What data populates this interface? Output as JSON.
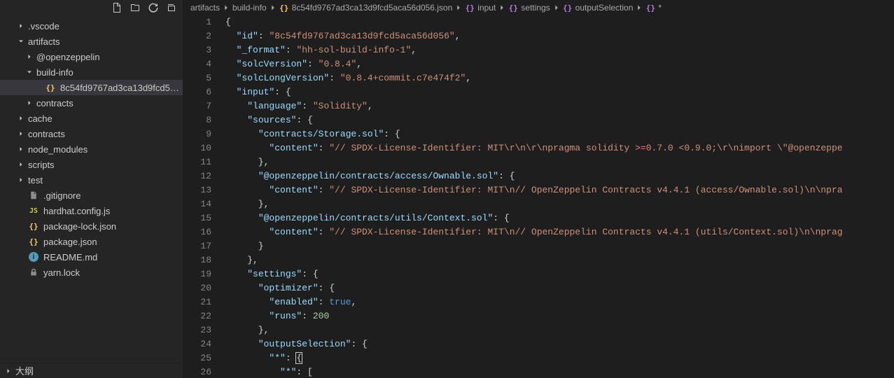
{
  "sidebar": {
    "items": [
      {
        "label": ".vscode",
        "kind": "folder",
        "expanded": false,
        "indent": 1
      },
      {
        "label": "artifacts",
        "kind": "folder",
        "expanded": true,
        "indent": 1
      },
      {
        "label": "@openzeppelin",
        "kind": "folder",
        "expanded": false,
        "indent": 2
      },
      {
        "label": "build-info",
        "kind": "folder",
        "expanded": true,
        "indent": 2
      },
      {
        "label": "8c54fd9767ad3ca13d9fcd5aca56...",
        "kind": "json",
        "indent": 3,
        "selected": true
      },
      {
        "label": "contracts",
        "kind": "folder",
        "expanded": false,
        "indent": 2
      },
      {
        "label": "cache",
        "kind": "folder",
        "expanded": false,
        "indent": 1
      },
      {
        "label": "contracts",
        "kind": "folder",
        "expanded": false,
        "indent": 1
      },
      {
        "label": "node_modules",
        "kind": "folder",
        "expanded": false,
        "indent": 1
      },
      {
        "label": "scripts",
        "kind": "folder",
        "expanded": false,
        "indent": 1
      },
      {
        "label": "test",
        "kind": "folder",
        "expanded": false,
        "indent": 1
      },
      {
        "label": ".gitignore",
        "kind": "file",
        "indent": 1
      },
      {
        "label": "hardhat.config.js",
        "kind": "js",
        "indent": 1
      },
      {
        "label": "package-lock.json",
        "kind": "json",
        "indent": 1
      },
      {
        "label": "package.json",
        "kind": "json",
        "indent": 1
      },
      {
        "label": "README.md",
        "kind": "info",
        "indent": 1
      },
      {
        "label": "yarn.lock",
        "kind": "lock",
        "indent": 1
      }
    ]
  },
  "outline": {
    "label": "大纲"
  },
  "breadcrumbs": [
    {
      "label": "artifacts",
      "icon": null
    },
    {
      "label": "build-info",
      "icon": null
    },
    {
      "label": "8c54fd9767ad3ca13d9fcd5aca56d056.json",
      "icon": "json-obj"
    },
    {
      "label": "input",
      "icon": "obj"
    },
    {
      "label": "settings",
      "icon": "obj"
    },
    {
      "label": "outputSelection",
      "icon": "obj"
    },
    {
      "label": "*",
      "icon": "obj"
    }
  ],
  "code": {
    "lines": [
      {
        "n": 1,
        "tokens": [
          {
            "t": "{",
            "c": "tok-punc"
          }
        ]
      },
      {
        "n": 2,
        "tokens": [
          {
            "t": "  ",
            "c": ""
          },
          {
            "t": "\"id\"",
            "c": "tok-key"
          },
          {
            "t": ": ",
            "c": "tok-punc"
          },
          {
            "t": "\"8c54fd9767ad3ca13d9fcd5aca56d056\"",
            "c": "tok-str"
          },
          {
            "t": ",",
            "c": "tok-punc"
          }
        ]
      },
      {
        "n": 3,
        "tokens": [
          {
            "t": "  ",
            "c": ""
          },
          {
            "t": "\"_format\"",
            "c": "tok-key"
          },
          {
            "t": ": ",
            "c": "tok-punc"
          },
          {
            "t": "\"hh-sol-build-info-1\"",
            "c": "tok-str"
          },
          {
            "t": ",",
            "c": "tok-punc"
          }
        ]
      },
      {
        "n": 4,
        "tokens": [
          {
            "t": "  ",
            "c": ""
          },
          {
            "t": "\"solcVersion\"",
            "c": "tok-key"
          },
          {
            "t": ": ",
            "c": "tok-punc"
          },
          {
            "t": "\"0.8.4\"",
            "c": "tok-str"
          },
          {
            "t": ",",
            "c": "tok-punc"
          }
        ]
      },
      {
        "n": 5,
        "tokens": [
          {
            "t": "  ",
            "c": ""
          },
          {
            "t": "\"solcLongVersion\"",
            "c": "tok-key"
          },
          {
            "t": ": ",
            "c": "tok-punc"
          },
          {
            "t": "\"0.8.4+commit.c7e474f2\"",
            "c": "tok-str"
          },
          {
            "t": ",",
            "c": "tok-punc"
          }
        ]
      },
      {
        "n": 6,
        "tokens": [
          {
            "t": "  ",
            "c": ""
          },
          {
            "t": "\"input\"",
            "c": "tok-key"
          },
          {
            "t": ": {",
            "c": "tok-punc"
          }
        ]
      },
      {
        "n": 7,
        "tokens": [
          {
            "t": "    ",
            "c": ""
          },
          {
            "t": "\"language\"",
            "c": "tok-key"
          },
          {
            "t": ": ",
            "c": "tok-punc"
          },
          {
            "t": "\"Solidity\"",
            "c": "tok-str"
          },
          {
            "t": ",",
            "c": "tok-punc"
          }
        ]
      },
      {
        "n": 8,
        "tokens": [
          {
            "t": "    ",
            "c": ""
          },
          {
            "t": "\"sources\"",
            "c": "tok-key"
          },
          {
            "t": ": {",
            "c": "tok-punc"
          }
        ]
      },
      {
        "n": 9,
        "tokens": [
          {
            "t": "      ",
            "c": ""
          },
          {
            "t": "\"contracts/Storage.sol\"",
            "c": "tok-key"
          },
          {
            "t": ": {",
            "c": "tok-punc"
          }
        ]
      },
      {
        "n": 10,
        "tokens": [
          {
            "t": "        ",
            "c": ""
          },
          {
            "t": "\"content\"",
            "c": "tok-key"
          },
          {
            "t": ": ",
            "c": "tok-punc"
          },
          {
            "t": "\"// SPDX-License-Identifier: MIT\\r\\n\\r\\npragma solidity >=0.7.0 <0.9.0;\\r\\nimport \\\"@openzeppe",
            "c": "tok-str"
          }
        ]
      },
      {
        "n": 11,
        "tokens": [
          {
            "t": "      },",
            "c": "tok-punc"
          }
        ]
      },
      {
        "n": 12,
        "tokens": [
          {
            "t": "      ",
            "c": ""
          },
          {
            "t": "\"@openzeppelin/contracts/access/Ownable.sol\"",
            "c": "tok-key"
          },
          {
            "t": ": {",
            "c": "tok-punc"
          }
        ]
      },
      {
        "n": 13,
        "tokens": [
          {
            "t": "        ",
            "c": ""
          },
          {
            "t": "\"content\"",
            "c": "tok-key"
          },
          {
            "t": ": ",
            "c": "tok-punc"
          },
          {
            "t": "\"// SPDX-License-Identifier: MIT\\n// OpenZeppelin Contracts v4.4.1 (access/Ownable.sol)\\n\\npra",
            "c": "tok-str"
          }
        ]
      },
      {
        "n": 14,
        "tokens": [
          {
            "t": "      },",
            "c": "tok-punc"
          }
        ]
      },
      {
        "n": 15,
        "tokens": [
          {
            "t": "      ",
            "c": ""
          },
          {
            "t": "\"@openzeppelin/contracts/utils/Context.sol\"",
            "c": "tok-key"
          },
          {
            "t": ": {",
            "c": "tok-punc"
          }
        ]
      },
      {
        "n": 16,
        "tokens": [
          {
            "t": "        ",
            "c": ""
          },
          {
            "t": "\"content\"",
            "c": "tok-key"
          },
          {
            "t": ": ",
            "c": "tok-punc"
          },
          {
            "t": "\"// SPDX-License-Identifier: MIT\\n// OpenZeppelin Contracts v4.4.1 (utils/Context.sol)\\n\\nprag",
            "c": "tok-str"
          }
        ]
      },
      {
        "n": 17,
        "tokens": [
          {
            "t": "      }",
            "c": "tok-punc"
          }
        ]
      },
      {
        "n": 18,
        "tokens": [
          {
            "t": "    },",
            "c": "tok-punc"
          }
        ]
      },
      {
        "n": 19,
        "tokens": [
          {
            "t": "    ",
            "c": ""
          },
          {
            "t": "\"settings\"",
            "c": "tok-key"
          },
          {
            "t": ": {",
            "c": "tok-punc"
          }
        ]
      },
      {
        "n": 20,
        "tokens": [
          {
            "t": "      ",
            "c": ""
          },
          {
            "t": "\"optimizer\"",
            "c": "tok-key"
          },
          {
            "t": ": {",
            "c": "tok-punc"
          }
        ]
      },
      {
        "n": 21,
        "tokens": [
          {
            "t": "        ",
            "c": ""
          },
          {
            "t": "\"enabled\"",
            "c": "tok-key"
          },
          {
            "t": ": ",
            "c": "tok-punc"
          },
          {
            "t": "true",
            "c": "tok-kw"
          },
          {
            "t": ",",
            "c": "tok-punc"
          }
        ]
      },
      {
        "n": 22,
        "tokens": [
          {
            "t": "        ",
            "c": ""
          },
          {
            "t": "\"runs\"",
            "c": "tok-key"
          },
          {
            "t": ": ",
            "c": "tok-punc"
          },
          {
            "t": "200",
            "c": "tok-num"
          }
        ]
      },
      {
        "n": 23,
        "tokens": [
          {
            "t": "      },",
            "c": "tok-punc"
          }
        ]
      },
      {
        "n": 24,
        "tokens": [
          {
            "t": "      ",
            "c": ""
          },
          {
            "t": "\"outputSelection\"",
            "c": "tok-key"
          },
          {
            "t": ": {",
            "c": "tok-punc"
          }
        ]
      },
      {
        "n": 25,
        "tokens": [
          {
            "t": "        ",
            "c": ""
          },
          {
            "t": "\"*\"",
            "c": "tok-key"
          },
          {
            "t": ": ",
            "c": "tok-punc"
          },
          {
            "t": "{",
            "c": "tok-punc",
            "cursor": true
          }
        ]
      },
      {
        "n": 26,
        "tokens": [
          {
            "t": "          ",
            "c": ""
          },
          {
            "t": "\"*\"",
            "c": "tok-key"
          },
          {
            "t": ": [",
            "c": "tok-punc"
          }
        ]
      }
    ]
  }
}
